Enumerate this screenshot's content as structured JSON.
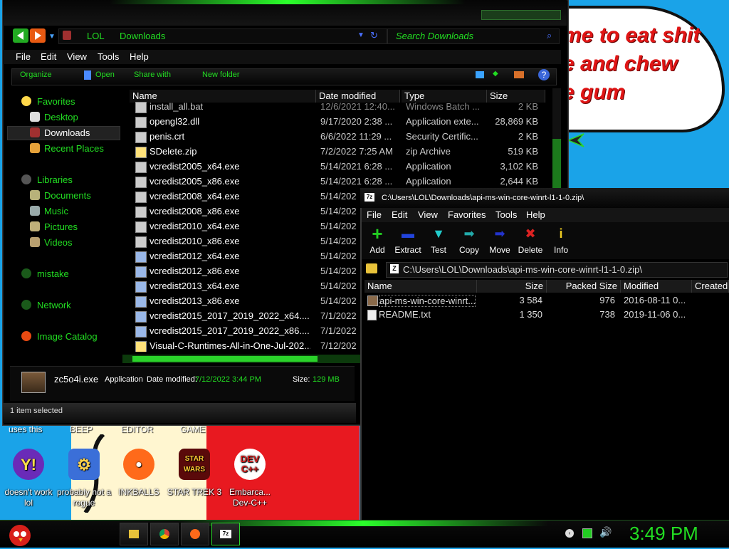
{
  "desktop": {
    "bubble_lines": [
      "me to eat shit",
      "e and chew",
      "e gum"
    ],
    "top_labels": [
      "uses this",
      "BEEP",
      "EDITOR",
      "GAME"
    ],
    "icons": [
      {
        "label": "doesn't work lol",
        "icon": "yahoo-messenger-icon"
      },
      {
        "label": "probably not a rogue",
        "icon": "gears-setup-icon"
      },
      {
        "label": "INKBALLS",
        "icon": "inkball-icon"
      },
      {
        "label": "STAR TREK 3",
        "icon": "star-trek-icon"
      },
      {
        "label": "Embarca... Dev-C++",
        "icon": "dev-cpp-icon"
      }
    ]
  },
  "explorer": {
    "breadcrumb": [
      "LOL",
      "Downloads"
    ],
    "search_placeholder": "Search Downloads",
    "menu": [
      "File",
      "Edit",
      "View",
      "Tools",
      "Help"
    ],
    "commands": [
      "Organize",
      "Open",
      "Share with",
      "New folder"
    ],
    "nav": [
      {
        "label": "Favorites",
        "icon": "star-icon"
      },
      {
        "label": "Desktop",
        "icon": "desktop-icon"
      },
      {
        "label": "Downloads",
        "icon": "downloads-icon"
      },
      {
        "label": "Recent Places",
        "icon": "recent-places-icon"
      },
      {
        "label": "Libraries",
        "icon": "libraries-icon"
      },
      {
        "label": "Documents",
        "icon": "documents-icon"
      },
      {
        "label": "Music",
        "icon": "music-icon"
      },
      {
        "label": "Pictures",
        "icon": "pictures-icon"
      },
      {
        "label": "Videos",
        "icon": "videos-icon"
      },
      {
        "label": "mistake",
        "icon": "homegroup-icon"
      },
      {
        "label": "Network",
        "icon": "network-icon"
      },
      {
        "label": "Image Catalog",
        "icon": "image-catalog-icon"
      }
    ],
    "columns": [
      "Name",
      "Date modified",
      "Type",
      "Size"
    ],
    "files": [
      {
        "name": "install_all.bat",
        "date": "12/6/2021 12:40...",
        "type": "Windows Batch ...",
        "size": "2 KB"
      },
      {
        "name": "opengl32.dll",
        "date": "9/17/2020 2:38 ...",
        "type": "Application exte...",
        "size": "28,869 KB"
      },
      {
        "name": "penis.crt",
        "date": "6/6/2022 11:29 ...",
        "type": "Security Certific...",
        "size": "2 KB"
      },
      {
        "name": "SDelete.zip",
        "date": "7/2/2022 7:25 AM",
        "type": "zip Archive",
        "size": "519 KB"
      },
      {
        "name": "vcredist2005_x64.exe",
        "date": "5/14/2021 6:28 ...",
        "type": "Application",
        "size": "3,102 KB"
      },
      {
        "name": "vcredist2005_x86.exe",
        "date": "5/14/2021 6:28 ...",
        "type": "Application",
        "size": "2,644 KB"
      },
      {
        "name": "vcredist2008_x64.exe",
        "date": "5/14/202",
        "type": "",
        "size": ""
      },
      {
        "name": "vcredist2008_x86.exe",
        "date": "5/14/202",
        "type": "",
        "size": ""
      },
      {
        "name": "vcredist2010_x64.exe",
        "date": "5/14/202",
        "type": "",
        "size": ""
      },
      {
        "name": "vcredist2010_x86.exe",
        "date": "5/14/202",
        "type": "",
        "size": ""
      },
      {
        "name": "vcredist2012_x64.exe",
        "date": "5/14/202",
        "type": "",
        "size": ""
      },
      {
        "name": "vcredist2012_x86.exe",
        "date": "5/14/202",
        "type": "",
        "size": ""
      },
      {
        "name": "vcredist2013_x64.exe",
        "date": "5/14/202",
        "type": "",
        "size": ""
      },
      {
        "name": "vcredist2013_x86.exe",
        "date": "5/14/202",
        "type": "",
        "size": ""
      },
      {
        "name": "vcredist2015_2017_2019_2022_x64....",
        "date": "7/1/2022",
        "type": "",
        "size": ""
      },
      {
        "name": "vcredist2015_2017_2019_2022_x86....",
        "date": "7/1/2022",
        "type": "",
        "size": ""
      },
      {
        "name": "Visual-C-Runtimes-All-in-One-Jul-202...",
        "date": "7/12/202",
        "type": "",
        "size": ""
      }
    ],
    "details": {
      "filename": "zc5o4i.exe",
      "type": "Application",
      "date_label": "Date modified:",
      "date_value": "7/12/2022 3:44 PM",
      "size_label": "Size:",
      "size_value": "129 MB"
    },
    "status": "1 item selected"
  },
  "zip": {
    "title": "C:\\Users\\LOL\\Downloads\\api-ms-win-core-winrt-l1-1-0.zip\\",
    "menu": [
      "File",
      "Edit",
      "View",
      "Favorites",
      "Tools",
      "Help"
    ],
    "toolbar": [
      {
        "label": "Add",
        "glyph": "+",
        "color": "#22cc22"
      },
      {
        "label": "Extract",
        "glyph": "▬",
        "color": "#2244dd"
      },
      {
        "label": "Test",
        "glyph": "▼",
        "color": "#22cccc"
      },
      {
        "label": "Copy",
        "glyph": "➡",
        "color": "#22aaaa"
      },
      {
        "label": "Move",
        "glyph": "➡",
        "color": "#2233cc"
      },
      {
        "label": "Delete",
        "glyph": "✖",
        "color": "#dd2222"
      },
      {
        "label": "Info",
        "glyph": "i",
        "color": "#eecc22"
      }
    ],
    "path": "C:\\Users\\LOL\\Downloads\\api-ms-win-core-winrt-l1-1-0.zip\\",
    "columns": [
      "Name",
      "Size",
      "Packed Size",
      "Modified",
      "Created"
    ],
    "files": [
      {
        "name": "api-ms-win-core-winrt...",
        "size": "3 584",
        "packed": "976",
        "modified": "2016-08-11 0..."
      },
      {
        "name": "README.txt",
        "size": "1 350",
        "packed": "738",
        "modified": "2019-11-06 0..."
      }
    ]
  },
  "taskbar": {
    "clock": "3:49 PM",
    "apps": [
      "explorer-icon",
      "chrome-icon",
      "inkball-icon",
      "7zip-icon"
    ],
    "start_icon": "angry-bird-start-icon",
    "tray": [
      "chevron-icon",
      "network-tray-icon",
      "volume-icon"
    ]
  },
  "colors": {
    "accent": "#22dd22",
    "background": "#000000",
    "desktop_blue": "#1aa3e8",
    "desktop_red": "#e81920"
  }
}
